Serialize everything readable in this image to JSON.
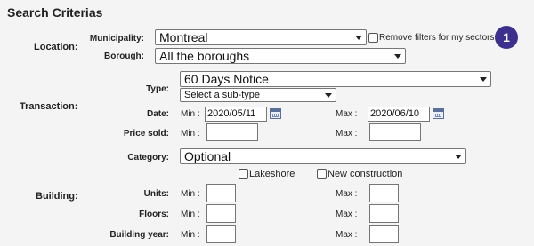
{
  "page_title": "Search Criterias",
  "badge": "1",
  "location": {
    "section": "Location:",
    "municipality_label": "Municipality:",
    "municipality_value": "Montreal",
    "remove_filters_label": "Remove filters for my sectors",
    "borough_label": "Borough:",
    "borough_value": "All the boroughs"
  },
  "transaction": {
    "section": "Transaction:",
    "type_label": "Type:",
    "type_value": "60 Days Notice",
    "subtype_placeholder": "Select a sub-type",
    "date_label": "Date:",
    "min_label": "Min :",
    "max_label": "Max :",
    "date_min": "2020/05/11",
    "date_max": "2020/06/10",
    "price_label": "Price sold:",
    "price_min": "",
    "price_max": ""
  },
  "category": {
    "label": "Category:",
    "value": "Optional",
    "lakeshore_label": "Lakeshore",
    "new_construction_label": "New construction"
  },
  "building": {
    "section": "Building:",
    "units_label": "Units:",
    "floors_label": "Floors:",
    "year_label": "Building year:",
    "min_label": "Min :",
    "max_label": "Max :",
    "units_min": "",
    "units_max": "",
    "floors_min": "",
    "floors_max": "",
    "year_min": "",
    "year_max": ""
  }
}
